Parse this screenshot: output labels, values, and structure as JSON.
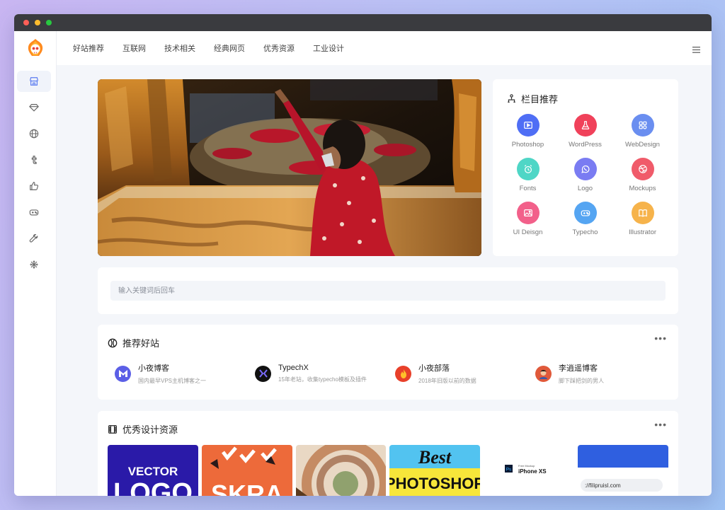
{
  "nav": {
    "items": [
      "好站推荐",
      "互联网",
      "技术相关",
      "经典网页",
      "优秀资源",
      "工业设计"
    ]
  },
  "sidebar": {
    "icons": [
      "store-icon",
      "diamond-icon",
      "globe-icon",
      "tumblr-icon",
      "thumbs-up-icon",
      "gamepad-icon",
      "wrench-icon",
      "snowflake-icon"
    ]
  },
  "category": {
    "title": "栏目推荐",
    "items": [
      {
        "label": "Photoshop",
        "icon": "play-box-icon",
        "color": "#4f6ef5"
      },
      {
        "label": "WordPress",
        "icon": "flask-icon",
        "color": "#f0415a"
      },
      {
        "label": "WebDesign",
        "icon": "grid-icon",
        "color": "#6a8ef0"
      },
      {
        "label": "Fonts",
        "icon": "alarm-icon",
        "color": "#4fd6c6"
      },
      {
        "label": "Logo",
        "icon": "whatsapp-icon",
        "color": "#7a7cf2"
      },
      {
        "label": "Mockups",
        "icon": "dribbble-icon",
        "color": "#f05b6a"
      },
      {
        "label": "UI Deisgn",
        "icon": "image-icon",
        "color": "#f2608a"
      },
      {
        "label": "Typecho",
        "icon": "gamepad-icon",
        "color": "#55a5f2"
      },
      {
        "label": "Illustrator",
        "icon": "book-icon",
        "color": "#f6b34b"
      }
    ]
  },
  "search": {
    "placeholder": "输入关键词后回车"
  },
  "sites": {
    "title": "推荐好站",
    "items": [
      {
        "name": "小夜博客",
        "desc": "国内最早VPS主机博客之一"
      },
      {
        "name": "TypechX",
        "desc": "15年老站，收集typecho模板及插件"
      },
      {
        "name": "小夜部落",
        "desc": "2018年旧版以前的数据"
      },
      {
        "name": "李逍遥博客",
        "desc": "脚下踩把剑的男人"
      }
    ]
  },
  "design": {
    "title": "优秀设计资源",
    "thumb_texts": {
      "vector": "VECTOR",
      "logo": "LOGO",
      "skra": "SKRA",
      "best": "Best",
      "photoshop": "PHOTOSHOP",
      "ps": "Ps",
      "mockup_label": "Free Mockup",
      "iphone": "iPhone XS",
      "url": "://filipruisl.com"
    }
  }
}
